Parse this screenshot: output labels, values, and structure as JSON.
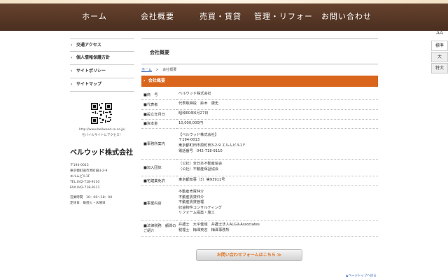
{
  "nav": {
    "items": [
      "ホーム",
      "会社概要",
      "売買・賃貸",
      "管理・リフォーム",
      "お問い合わせ"
    ]
  },
  "sidebar": {
    "links": [
      "交通アクセス",
      "個人情報保護方針",
      "サイトポリシー",
      "サイトマップ"
    ],
    "qr_url": "http://www.bellwood-re.co.jp/",
    "qr_caption": "モバイルサイトにアクセス！",
    "company": "ベルウッド株式会社",
    "address_lines": [
      "〒194-0013",
      "東京都町田市原町田3-2-9",
      "エルムビル1F",
      "TEL.042-718-9110",
      "FAX.042-718-9111",
      "",
      "営業時間　10：00〜18：00",
      "定休日　毎週火・水曜日"
    ]
  },
  "page": {
    "title": "会社概要",
    "breadcrumb_home": "ホーム",
    "breadcrumb_sep": ">",
    "breadcrumb_current": "会社概要",
    "section_title": "会社概要"
  },
  "company_info": [
    {
      "key": "■商　号",
      "lines": [
        "ベルウッド株式会社"
      ]
    },
    {
      "key": "■代表者",
      "lines": [
        "代表取締役　鈴木　康史"
      ]
    },
    {
      "key": "■設立年月日",
      "lines": [
        "昭和60年6月27日"
      ]
    },
    {
      "key": "■資本金",
      "lines": [
        "10,000,000円"
      ]
    },
    {
      "key": "■事務所案内",
      "lines": [
        "【ベルウッド株式会社】",
        "〒194-0013",
        "東京都町田市原町田3-2-9 エルムビル1Ｆ",
        "電話番号　042-718-9110"
      ]
    },
    {
      "key": "■加入団体",
      "lines": [
        "（公社）全日本不動産協会",
        "（公社）不動産保証協会"
      ]
    },
    {
      "key": "■宅建業免許",
      "lines": [
        "東京都知事（3）第93911号"
      ]
    },
    {
      "key": "■事業内容",
      "lines": [
        "不動産売買仲介",
        "不動産賃貸仲介",
        "不動産賃貸管理",
        "収益物件コンサルティング",
        "リフォーム提案・施工"
      ]
    },
    {
      "key": "■法律税務　顧問のご紹介",
      "lines": [
        "弁護士　大平健城　弁護士法人ALG＆Associates",
        "税理士　梅澤英志　梅澤事務所"
      ]
    }
  ],
  "inquiry_button": "お問い合わせフォームはこちら ≫",
  "page_top": "▲ページトップへ戻る",
  "font_size": {
    "icon": "AA",
    "options": [
      "標準",
      "大",
      "特大"
    ]
  }
}
